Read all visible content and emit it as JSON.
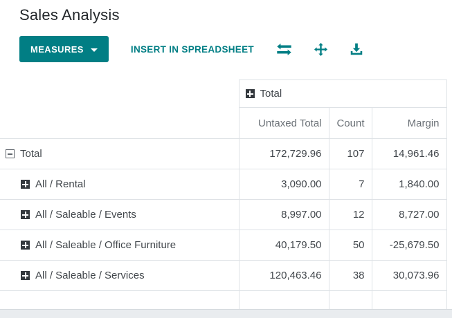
{
  "page": {
    "title": "Sales Analysis"
  },
  "toolbar": {
    "measures_label": "MEASURES",
    "insert_label": "INSERT IN SPREADSHEET",
    "accent_color": "#017e84",
    "icons": [
      "flip-axis-icon",
      "expand-all-icon",
      "download-icon"
    ]
  },
  "pivot": {
    "column_group": {
      "label": "Total",
      "expander": "plus"
    },
    "measure_headers": [
      "Untaxed Total",
      "Count",
      "Margin"
    ],
    "rows": [
      {
        "label": "Total",
        "expander": "minus",
        "indent": 0,
        "values": [
          "172,729.96",
          "107",
          "14,961.46"
        ]
      },
      {
        "label": "All / Rental",
        "expander": "plus",
        "indent": 1,
        "values": [
          "3,090.00",
          "7",
          "1,840.00"
        ]
      },
      {
        "label": "All / Saleable / Events",
        "expander": "plus",
        "indent": 1,
        "values": [
          "8,997.00",
          "12",
          "8,727.00"
        ]
      },
      {
        "label": "All / Saleable / Office Furniture",
        "expander": "plus",
        "indent": 1,
        "values": [
          "40,179.50",
          "50",
          "-25,679.50"
        ]
      },
      {
        "label": "All / Saleable / Services",
        "expander": "plus",
        "indent": 1,
        "values": [
          "120,463.46",
          "38",
          "30,073.96"
        ]
      }
    ]
  }
}
